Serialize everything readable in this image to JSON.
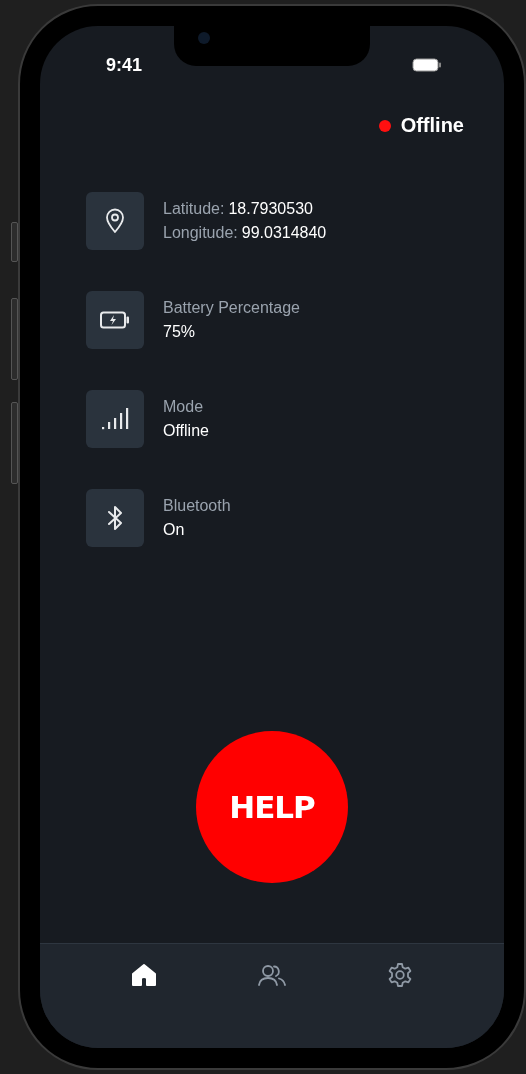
{
  "status_bar": {
    "time": "9:41"
  },
  "connection": {
    "label": "Offline",
    "color": "#ff1010"
  },
  "info_items": [
    {
      "kind": "location",
      "lines": [
        {
          "label": "Latitude:",
          "value": "18.7930530"
        },
        {
          "label": "Longitude:",
          "value": "99.0314840"
        }
      ]
    },
    {
      "kind": "battery",
      "title": "Battery Percentage",
      "value": "75%"
    },
    {
      "kind": "signal",
      "title": "Mode",
      "value": "Offline"
    },
    {
      "kind": "bluetooth",
      "title": "Bluetooth",
      "value": "On"
    }
  ],
  "help_button": {
    "label": "HELP"
  },
  "nav": [
    {
      "kind": "home",
      "selected": true
    },
    {
      "kind": "people",
      "selected": false
    },
    {
      "kind": "settings",
      "selected": false
    }
  ]
}
